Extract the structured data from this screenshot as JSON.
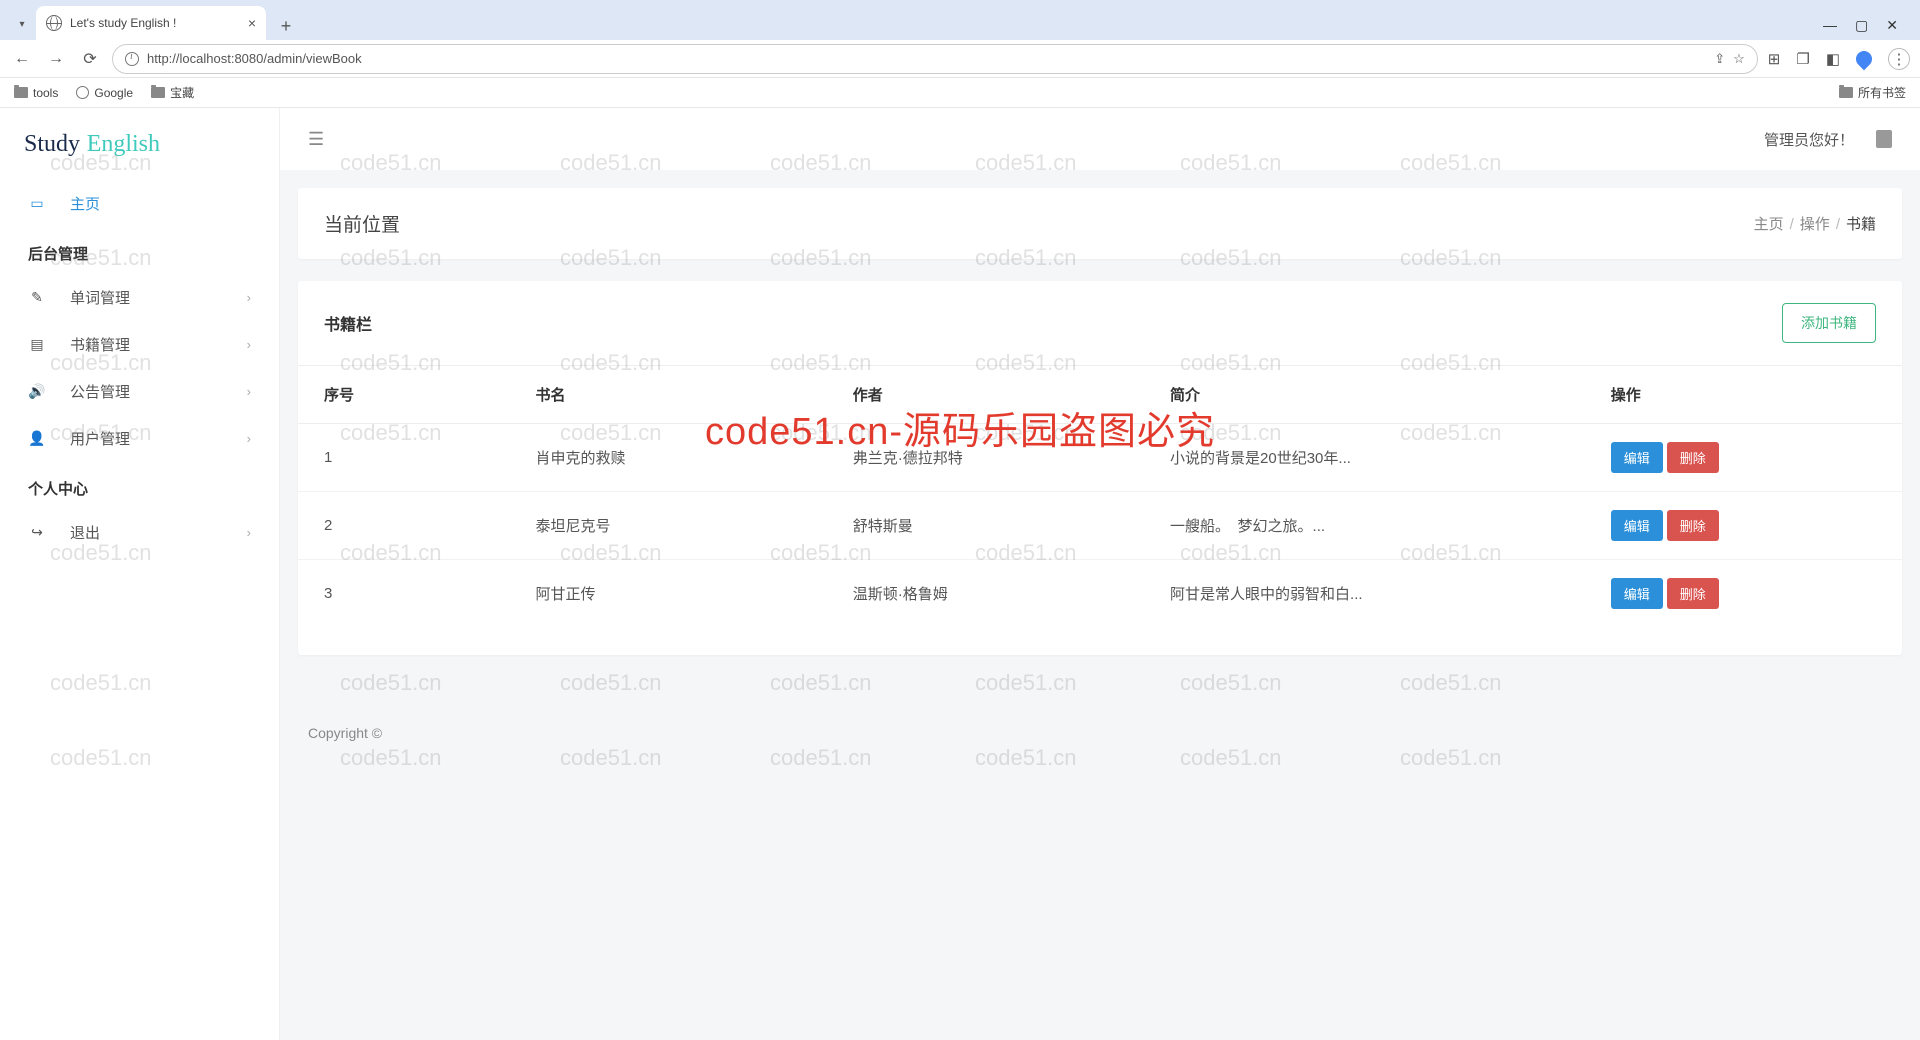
{
  "browser": {
    "tab_title": "Let's study English !",
    "url": "http://localhost:8080/admin/viewBook",
    "bookmarks": [
      "tools",
      "Google",
      "宝藏"
    ],
    "all_bookmarks": "所有书签"
  },
  "logo": {
    "part1": "Study",
    "part2": "English"
  },
  "sidebar": {
    "home": "主页",
    "section1": "后台管理",
    "items1": [
      "单词管理",
      "书籍管理",
      "公告管理",
      "用户管理"
    ],
    "section2": "个人中心",
    "logout": "退出"
  },
  "topbar": {
    "greeting": "管理员您好！"
  },
  "breadcrumb": {
    "title": "当前位置",
    "home": "主页",
    "op": "操作",
    "current": "书籍"
  },
  "table": {
    "title": "书籍栏",
    "add_btn": "添加书籍",
    "columns": [
      "序号",
      "书名",
      "作者",
      "简介",
      "操作"
    ],
    "edit": "编辑",
    "delete": "删除",
    "rows": [
      {
        "id": "1",
        "name": "肖申克的救赎",
        "author": "弗兰克·德拉邦特",
        "desc": "小说的背景是20世纪30年..."
      },
      {
        "id": "2",
        "name": "泰坦尼克号",
        "author": "舒特斯曼",
        "desc": "一艘船。　梦幻之旅。..."
      },
      {
        "id": "3",
        "name": "阿甘正传",
        "author": "温斯顿·格鲁姆",
        "desc": "阿甘是常人眼中的弱智和白..."
      }
    ]
  },
  "footer": "Copyright ©",
  "overlay": "code51.cn-源码乐园盗图必究",
  "watermark": "code51.cn"
}
